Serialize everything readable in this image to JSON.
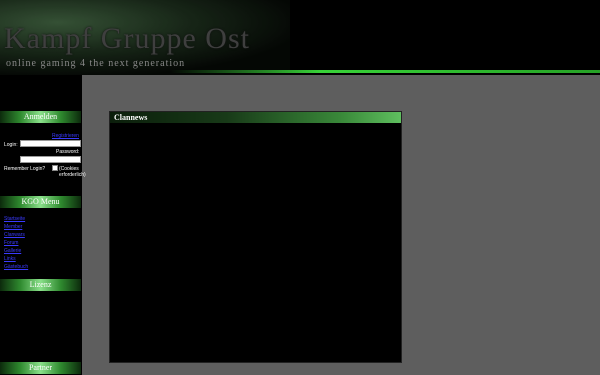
{
  "header": {
    "title": "Kampf Gruppe Ost",
    "subtitle": "online gaming 4 the next generation"
  },
  "sidebar": {
    "login_section_title": "Anmelden",
    "register_link": "Registrieren",
    "login_label": "Login:",
    "password_label": "Password:",
    "remember_label": "Remember Login?",
    "cookies_note": "(Cookies erforderlich)",
    "menu_section_title": "KGO Menu",
    "menu_items": [
      "Startseite",
      "Member",
      "Clanwars",
      "Forum",
      "Gallerie",
      "Links",
      "Gästebuch"
    ],
    "section3_title": "Lizenz",
    "section4_title": "Partner"
  },
  "main": {
    "news_title": "Clannews"
  },
  "colors": {
    "accent_green": "#39d339",
    "link_blue": "#3a3aff",
    "content_gray": "#5e5e5e"
  }
}
